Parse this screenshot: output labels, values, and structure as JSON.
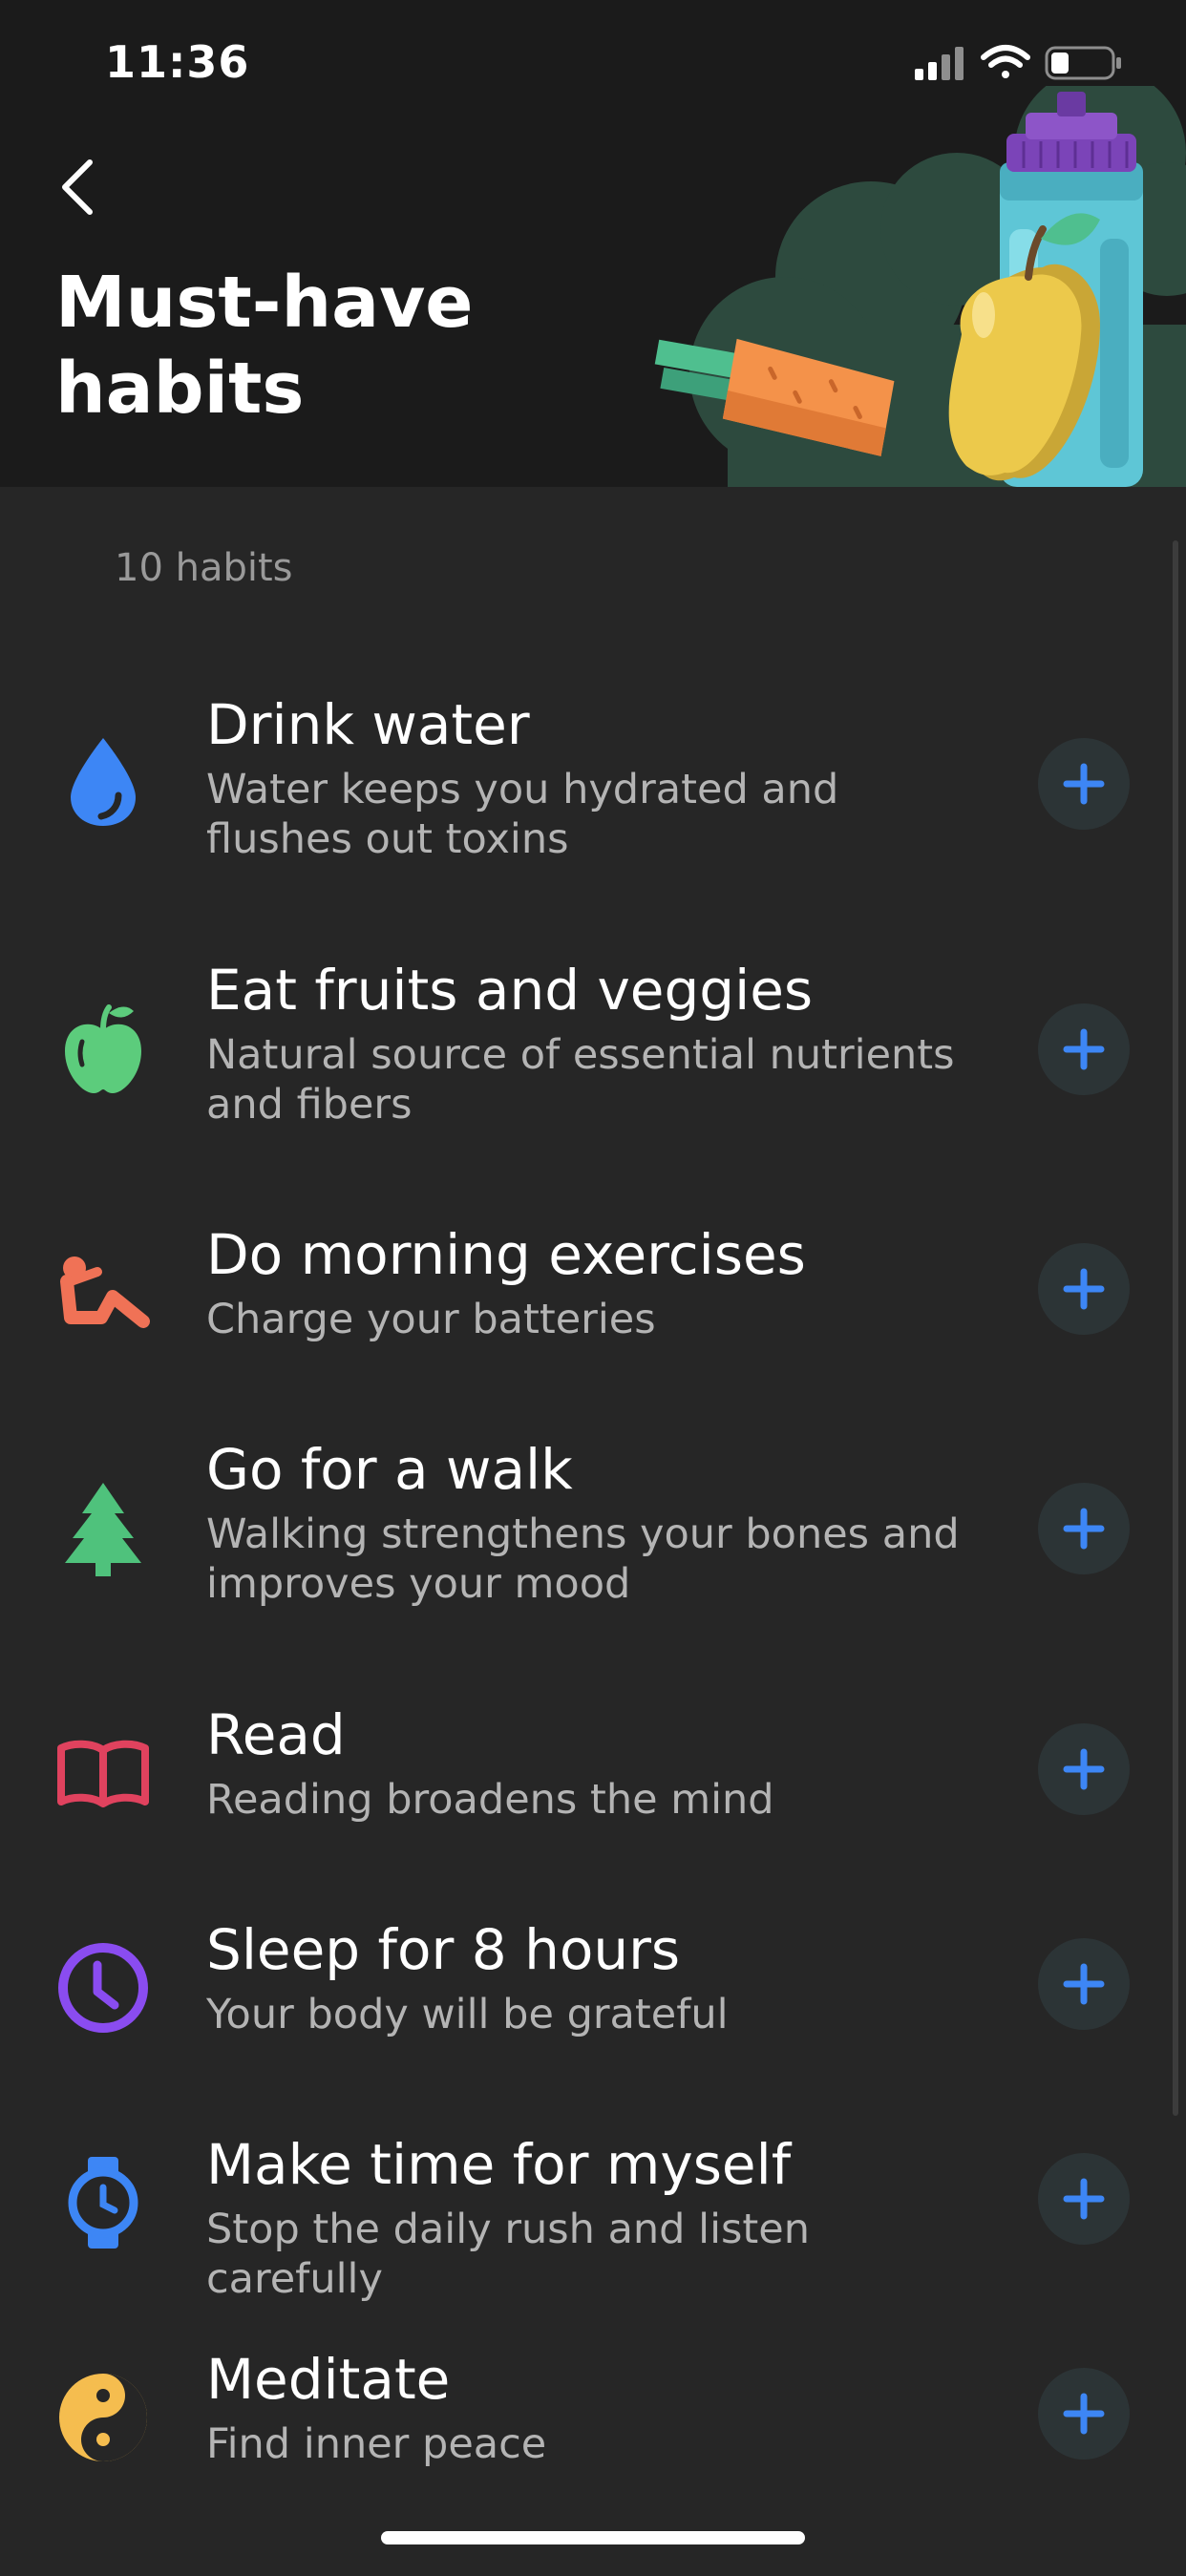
{
  "status_bar": {
    "time": "11:36"
  },
  "header": {
    "title": "Must-have\nhabits"
  },
  "list": {
    "count_label": "10 habits",
    "items": [
      {
        "title": "Drink water",
        "description": "Water keeps you hydrated and flushes out toxins",
        "icon": "water-drop-icon",
        "icon_color": "#3d86f5"
      },
      {
        "title": "Eat fruits and veggies",
        "description": "Natural source of essential nutrients and fibers",
        "icon": "apple-icon",
        "icon_color": "#5ccc7c"
      },
      {
        "title": "Do morning exercises",
        "description": "Charge your batteries",
        "icon": "exercise-icon",
        "icon_color": "#f07256"
      },
      {
        "title": "Go for a walk",
        "description": "Walking strengthens your bones and improves your mood",
        "icon": "tree-icon",
        "icon_color": "#4fc27c"
      },
      {
        "title": "Read",
        "description": "Reading broadens the mind",
        "icon": "book-icon",
        "icon_color": "#e0425e"
      },
      {
        "title": "Sleep for 8 hours",
        "description": "Your body will be grateful",
        "icon": "clock-icon",
        "icon_color": "#8a4cf0"
      },
      {
        "title": "Make time for myself",
        "description": "Stop the daily rush and listen carefully",
        "icon": "watch-icon",
        "icon_color": "#3d86f5"
      },
      {
        "title": "Meditate",
        "description": "Find inner peace",
        "icon": "yin-yang-icon",
        "icon_color": "#f5bd4f"
      }
    ]
  },
  "colors": {
    "accent_blue": "#3d86f5",
    "background": "#262626",
    "header_background": "#1b1b1b"
  }
}
